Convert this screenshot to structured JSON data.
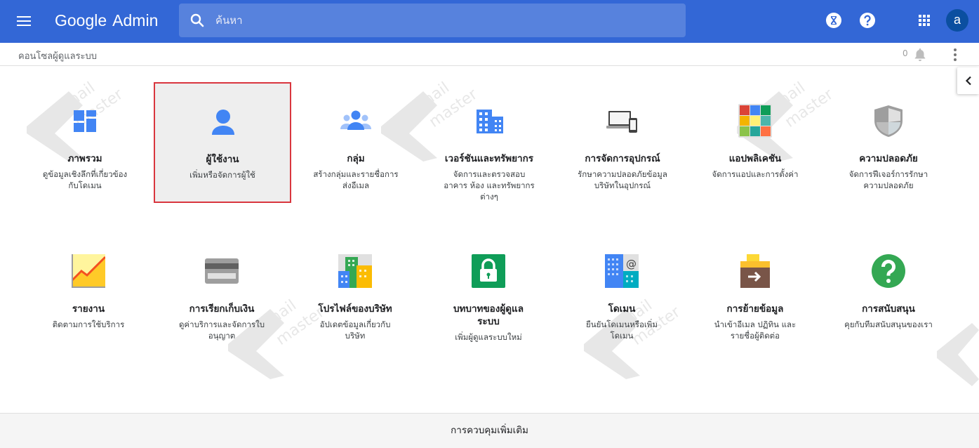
{
  "header": {
    "menu_icon": "menu-icon",
    "logo_google": "Google",
    "logo_admin": "Admin",
    "search_placeholder": "ค้นหา",
    "avatar_letter": "a",
    "icons": [
      "hourglass-icon",
      "help-icon",
      "apps-grid-icon"
    ]
  },
  "subheader": {
    "breadcrumb": "คอนโซลผู้ดูแลระบบ",
    "notification_count": "0"
  },
  "tiles": [
    {
      "title": "ภาพรวม",
      "desc1": "ดูข้อมูลเชิงลึกที่เกี่ยวข้อง",
      "desc2": "กับโดเมน",
      "desc3": ""
    },
    {
      "title": "ผู้ใช้งาน",
      "desc1": "เพิ่มหรือจัดการผู้ใช้",
      "desc2": "",
      "desc3": ""
    },
    {
      "title": "กลุ่ม",
      "desc1": "สร้างกลุ่มและรายชื่อการ",
      "desc2": "ส่งอีเมล",
      "desc3": ""
    },
    {
      "title": "เวอร์ชันและทรัพยากร",
      "desc1": "จัดการและตรวจสอบ",
      "desc2": "อาคาร ห้อง และทรัพยากร",
      "desc3": "ต่างๆ"
    },
    {
      "title": "การจัดการอุปกรณ์",
      "desc1": "รักษาความปลอดภัยข้อมูล",
      "desc2": "บริษัทในอุปกรณ์",
      "desc3": ""
    },
    {
      "title": "แอปพลิเคชัน",
      "desc1": "จัดการแอปและการตั้งค่า",
      "desc2": "",
      "desc3": ""
    },
    {
      "title": "ความปลอดภัย",
      "desc1": "จัดการฟีเจอร์การรักษา",
      "desc2": "ความปลอดภัย",
      "desc3": ""
    },
    {
      "title": "รายงาน",
      "desc1": "ติดตามการใช้บริการ",
      "desc2": "",
      "desc3": ""
    },
    {
      "title": "การเรียกเก็บเงิน",
      "desc1": "ดูค่าบริการและจัดการใบ",
      "desc2": "อนุญาต",
      "desc3": ""
    },
    {
      "title": "โปรไฟล์ของบริษัท",
      "desc1": "อัปเดตข้อมูลเกี่ยวกับ",
      "desc2": "บริษัท",
      "desc3": ""
    },
    {
      "title": "บทบาทของผู้ดูแล",
      "title2": "ระบบ",
      "desc1": "เพิ่มผู้ดูแลระบบใหม่",
      "desc2": "",
      "desc3": ""
    },
    {
      "title": "โดเมน",
      "desc1": "ยืนยันโดเมนหรือเพิ่ม",
      "desc2": "โดเมน",
      "desc3": ""
    },
    {
      "title": "การย้ายข้อมูล",
      "desc1": "นำเข้าอีเมล ปฏิทิน และ",
      "desc2": "รายชื่อผู้ติดต่อ",
      "desc3": ""
    },
    {
      "title": "การสนับสนุน",
      "desc1": "คุยกับทีมสนับสนุนของเรา",
      "desc2": "",
      "desc3": ""
    }
  ],
  "footer": {
    "label": "การควบคุมเพิ่มเติม"
  },
  "colors": {
    "appbar": "#3367d6",
    "selected_border": "#d9363e",
    "icon_blue": "#4285f4"
  }
}
